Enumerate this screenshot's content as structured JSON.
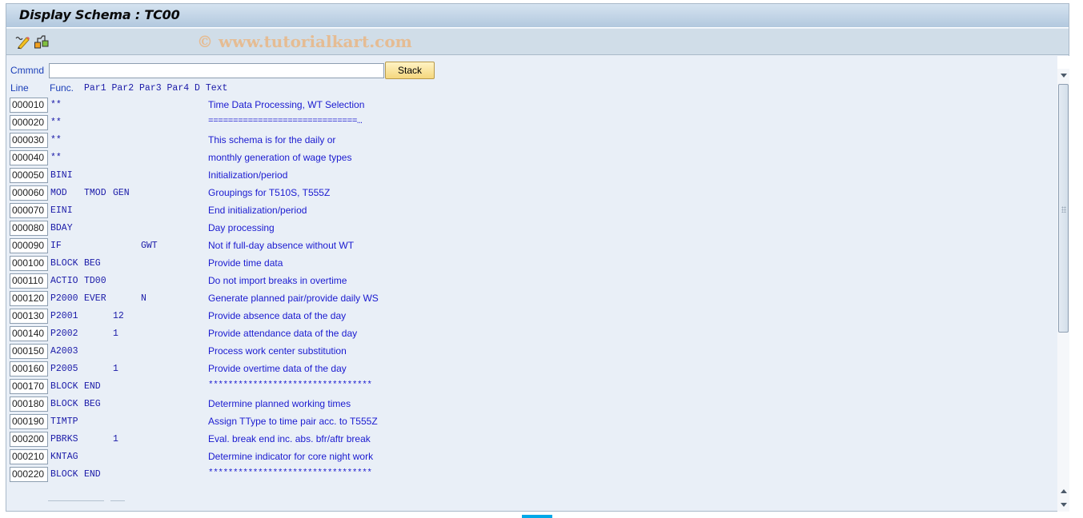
{
  "window": {
    "title": "Display Schema : TC00",
    "watermark": "© www.tutorialkart.com"
  },
  "toolbar": {
    "icons": [
      "display-change-icon",
      "hierarchy-icon"
    ]
  },
  "command": {
    "label": "Cmmnd",
    "value": "",
    "placeholder": "",
    "stack_button": "Stack"
  },
  "headers": {
    "line": "Line",
    "func": "Func.",
    "params": "Par1 Par2 Par3 Par4 D Text"
  },
  "rows": [
    {
      "line": "000010",
      "func": "**",
      "par1": "",
      "par2": "",
      "par3": "",
      "text": "Time Data Processing, WT Selection"
    },
    {
      "line": "000020",
      "func": "**",
      "par1": "",
      "par2": "",
      "par3": "",
      "text": "==============================…"
    },
    {
      "line": "000030",
      "func": "**",
      "par1": "",
      "par2": "",
      "par3": "",
      "text": "This schema is for the daily or"
    },
    {
      "line": "000040",
      "func": "**",
      "par1": "",
      "par2": "",
      "par3": "",
      "text": "monthly generation of wage types"
    },
    {
      "line": "000050",
      "func": "BINI",
      "par1": "",
      "par2": "",
      "par3": "",
      "text": "Initialization/period"
    },
    {
      "line": "000060",
      "func": "MOD",
      "par1": "TMOD",
      "par2": "GEN",
      "par3": "",
      "text": "Groupings for T510S, T555Z"
    },
    {
      "line": "000070",
      "func": "EINI",
      "par1": "",
      "par2": "",
      "par3": "",
      "text": "End initialization/period"
    },
    {
      "line": "000080",
      "func": "BDAY",
      "par1": "",
      "par2": "",
      "par3": "",
      "text": "Day processing"
    },
    {
      "line": "000090",
      "func": "IF",
      "par1": "",
      "par2": "",
      "par3": "GWT",
      "text": "Not if full-day absence without WT"
    },
    {
      "line": "000100",
      "func": "BLOCK",
      "par1": "BEG",
      "par2": "",
      "par3": "",
      "text": "Provide time data"
    },
    {
      "line": "000110",
      "func": "ACTIO",
      "par1": "TD00",
      "par2": "",
      "par3": "",
      "text": "Do not import breaks in overtime"
    },
    {
      "line": "000120",
      "func": "P2000",
      "par1": "EVER",
      "par2": "",
      "par3": "N",
      "text": "Generate planned pair/provide daily WS"
    },
    {
      "line": "000130",
      "func": "P2001",
      "par1": "",
      "par2": "12",
      "par3": "",
      "text": "Provide absence data of the day"
    },
    {
      "line": "000140",
      "func": "P2002",
      "par1": "",
      "par2": "1",
      "par3": "",
      "text": "Provide attendance data of the day"
    },
    {
      "line": "000150",
      "func": "A2003",
      "par1": "",
      "par2": "",
      "par3": "",
      "text": "Process work center substitution"
    },
    {
      "line": "000160",
      "func": "P2005",
      "par1": "",
      "par2": "1",
      "par3": "",
      "text": "Provide overtime data of the day"
    },
    {
      "line": "000170",
      "func": "BLOCK",
      "par1": "END",
      "par2": "",
      "par3": "",
      "text": "*********************************"
    },
    {
      "line": "000180",
      "func": "BLOCK",
      "par1": "BEG",
      "par2": "",
      "par3": "",
      "text": "Determine planned working times"
    },
    {
      "line": "000190",
      "func": "TIMTP",
      "par1": "",
      "par2": "",
      "par3": "",
      "text": "Assign TType to time pair acc. to T555Z"
    },
    {
      "line": "000200",
      "func": "PBRKS",
      "par1": "",
      "par2": "1",
      "par3": "",
      "text": "Eval. break end inc. abs. bfr/aftr break"
    },
    {
      "line": "000210",
      "func": "KNTAG",
      "par1": "",
      "par2": "",
      "par3": "",
      "text": "Determine indicator for core night work"
    },
    {
      "line": "000220",
      "func": "BLOCK",
      "par1": "END",
      "par2": "",
      "par3": "",
      "text": "*********************************"
    }
  ],
  "colors": {
    "text_blue": "#1a1ad0",
    "label_blue": "#1a3eb8",
    "button_yellow": "#f5d77e",
    "background": "#e9eff7"
  }
}
